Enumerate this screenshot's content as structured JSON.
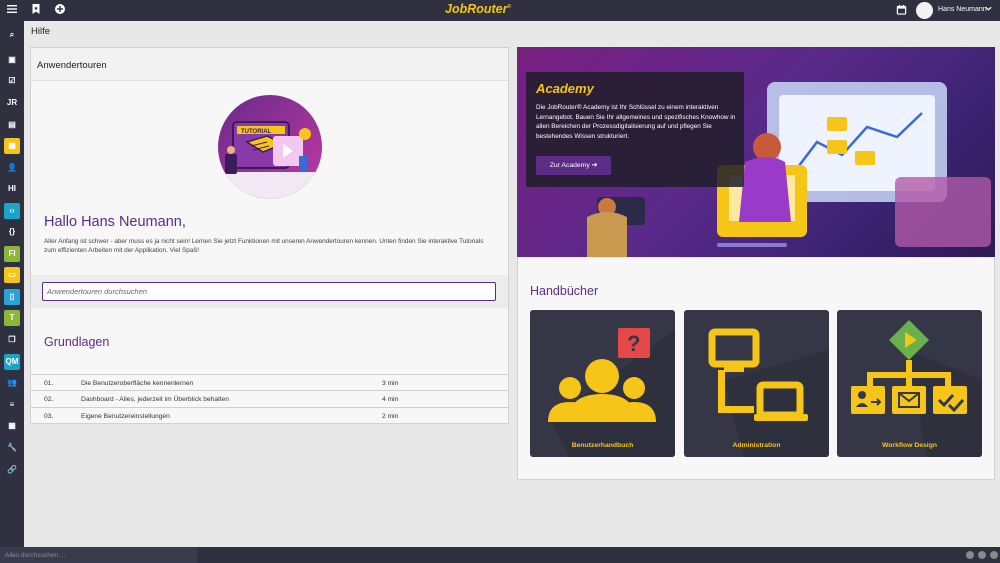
{
  "app": {
    "logo": "JobRouter",
    "logo_mark": "®",
    "user_name": "Hans Neumann"
  },
  "icons": {
    "menu": "hamburger-icon",
    "bookmark": "bookmark-icon",
    "add": "plus-circle-icon",
    "calendar": "calendar-icon",
    "user_menu": "chevron-down-icon"
  },
  "sidebar": {
    "items": [
      {
        "icon": "search-icon",
        "glyph": "⌕",
        "color": "#2f3040"
      },
      {
        "icon": "inbox-icon",
        "glyph": "▣",
        "color": "#2f3040"
      },
      {
        "icon": "checkbox-icon",
        "glyph": "☑",
        "color": "#2f3040"
      },
      {
        "icon": "jr-icon",
        "glyph": "JR",
        "color": "#2f3040"
      },
      {
        "icon": "document-icon",
        "glyph": "▤",
        "color": "#2f3040"
      },
      {
        "icon": "archive-icon",
        "glyph": "▦",
        "color": "#f5c518"
      },
      {
        "icon": "users-icon",
        "glyph": "👤",
        "color": "#2f3040"
      },
      {
        "icon": "hi-icon",
        "glyph": "HI",
        "color": "#2f3040"
      },
      {
        "icon": "code-icon",
        "glyph": "‹›",
        "color": "#1aa5c8"
      },
      {
        "icon": "braces-icon",
        "glyph": "{}",
        "color": "#2f3040"
      },
      {
        "icon": "fi-icon",
        "glyph": "FI",
        "color": "#8bb83a"
      },
      {
        "icon": "form-icon",
        "glyph": "▭",
        "color": "#f5c518"
      },
      {
        "icon": "book-icon",
        "glyph": "▯",
        "color": "#2aa3d8"
      },
      {
        "icon": "t-icon",
        "glyph": "T",
        "color": "#8bb83a"
      },
      {
        "icon": "copy-icon",
        "glyph": "❐",
        "color": "#2f3040"
      },
      {
        "icon": "qm-icon",
        "glyph": "QM",
        "color": "#1aa5c8"
      },
      {
        "icon": "group-icon",
        "glyph": "👥",
        "color": "#2f3040"
      },
      {
        "icon": "list-icon",
        "glyph": "≡",
        "color": "#2f3040"
      },
      {
        "icon": "table-icon",
        "glyph": "▦",
        "color": "#2f3040"
      },
      {
        "icon": "wrench-icon",
        "glyph": "🔧",
        "color": "#2f3040"
      },
      {
        "icon": "link-icon",
        "glyph": "🔗",
        "color": "#2f3040"
      }
    ]
  },
  "page": {
    "title": "Hilfe"
  },
  "tours": {
    "panel_title": "Anwendertouren",
    "greeting": "Hallo Hans Neumann,",
    "intro": "Aller Anfang ist schwer - aber muss es ja nicht sein! Lernen Sie jetzt Funktionen mit unseren Anwendertouren kennen. Unten finden Sie interaktive Tutorials zum effizienten Arbeiten mit der Applikation. Viel Spaß!",
    "illustration_label": "TUTORIAL",
    "search_placeholder": "Anwendertouren durchsuchen",
    "section_title": "Grundlagen",
    "rows": [
      {
        "num": "01.",
        "title": "Die Benutzeroberfläche kennenlernen",
        "duration": "3 min"
      },
      {
        "num": "02.",
        "title": "Dashboard - Alles, jederzeit im Überblick behalten",
        "duration": "4 min"
      },
      {
        "num": "03.",
        "title": "Eigene Benutzereinstellungen",
        "duration": "2 min"
      }
    ]
  },
  "academy": {
    "title": "Academy",
    "text": "Die JobRouter® Academy ist Ihr Schlüssel zu einem interaktiven Lernangebot. Bauen Sie Ihr allgemeines und spezifisches Knowhow in allen Bereichen der Prozessdigitalisierung auf und pflegen Sie bestehendes Wissen strukturiert.",
    "button": "Zur Academy ➔"
  },
  "manuals": {
    "title": "Handbücher",
    "tiles": [
      {
        "label": "Benutzerhandbuch",
        "icon": "users-question-icon"
      },
      {
        "label": "Administration",
        "icon": "network-admin-icon"
      },
      {
        "label": "Workflow Design",
        "icon": "workflow-icon"
      }
    ]
  },
  "footer": {
    "search_placeholder": "Alles durchsuchen ..."
  },
  "colors": {
    "accent": "#5c2c86",
    "brand_yellow": "#f5c518",
    "dark": "#2f3040"
  }
}
